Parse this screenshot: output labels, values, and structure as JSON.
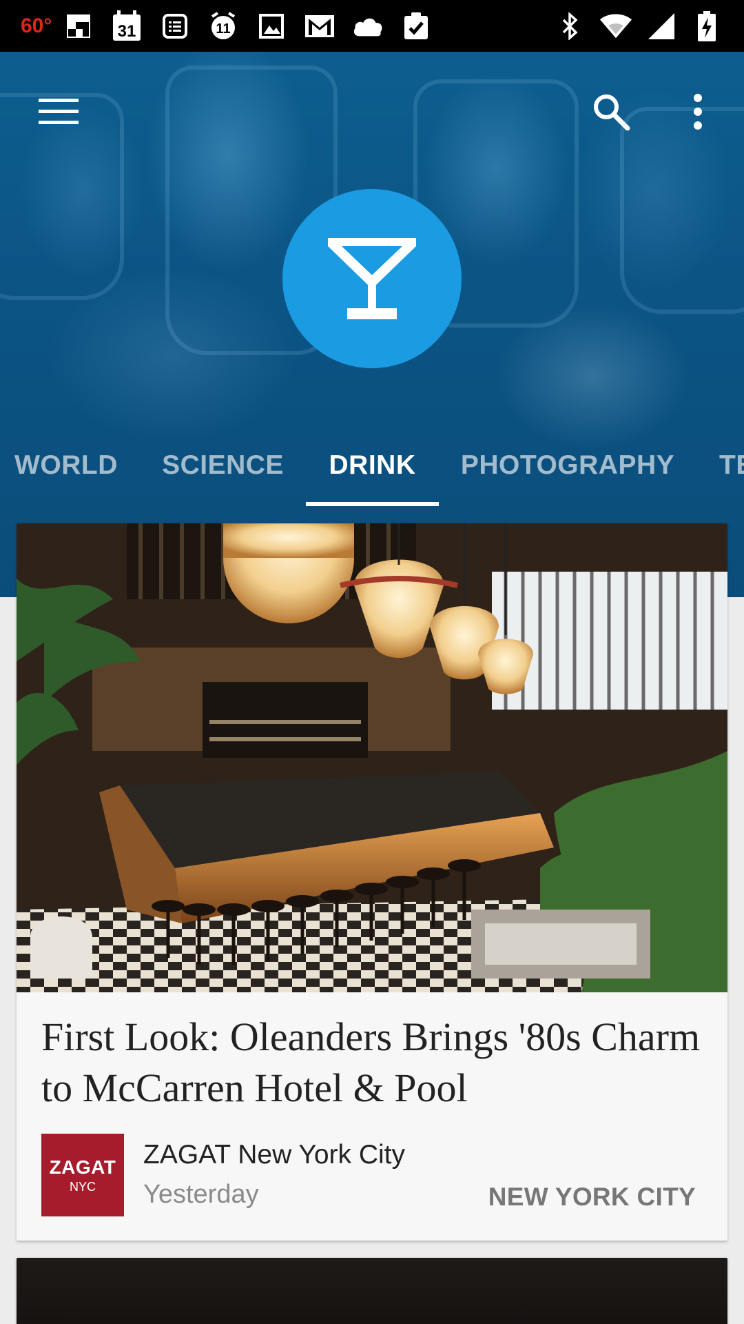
{
  "status_bar": {
    "temperature": "60°",
    "left_icons": [
      "flipboard-icon",
      "calendar-icon",
      "news-icon",
      "alarm-icon",
      "gallery-icon",
      "gmail-icon",
      "cloud-icon",
      "tasks-icon"
    ],
    "calendar_day": "31",
    "alarm_number": "11",
    "right_icons": [
      "bluetooth-icon",
      "wifi-icon",
      "signal-icon",
      "battery-charging-icon"
    ]
  },
  "header": {
    "category_icon": "martini-glass-icon",
    "accent_color": "#1a9be2"
  },
  "tabs": [
    {
      "label": "WORLD",
      "active": false
    },
    {
      "label": "SCIENCE",
      "active": false
    },
    {
      "label": "DRINK",
      "active": true
    },
    {
      "label": "PHOTOGRAPHY",
      "active": false
    },
    {
      "label": "TE",
      "active": false
    }
  ],
  "article": {
    "title": "First Look: Oleanders Brings '80s Charm to McCarren Hotel & Pool",
    "source_logo_line1": "ZAGAT",
    "source_logo_line2": "NYC",
    "source_logo_color": "#a51d2d",
    "source_name": "ZAGAT New York City",
    "time": "Yesterday",
    "location": "NEW YORK CITY"
  }
}
